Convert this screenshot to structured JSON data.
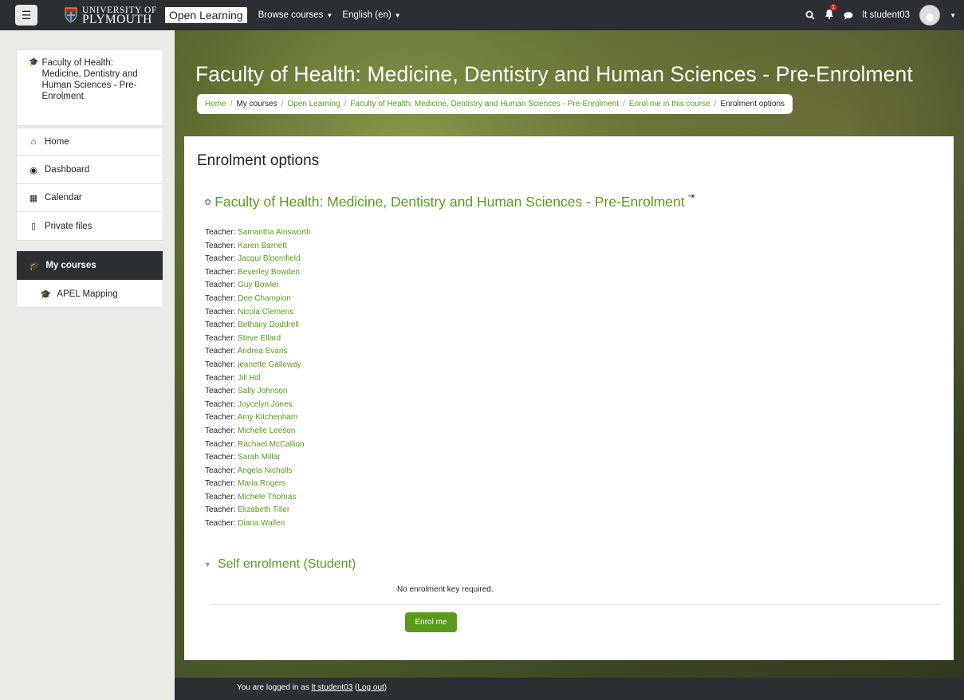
{
  "navbar": {
    "logo_line1": "UNIVERSITY OF",
    "logo_line2": "PLYMOUTH",
    "site_name": "Open Learning",
    "browse_label": "Browse courses",
    "language_label": "English (en)",
    "notifications_count": "1",
    "user_name": "lt student03"
  },
  "drawer": {
    "course_name_lines": [
      "Faculty of Health:",
      "Medicine, Dentistry and",
      "Human Sciences - Pre-",
      "Enrolment"
    ],
    "nav_items": [
      {
        "label": "Home",
        "icon": "home-icon"
      },
      {
        "label": "Dashboard",
        "icon": "dashboard-icon"
      },
      {
        "label": "Calendar",
        "icon": "calendar-icon"
      },
      {
        "label": "Private files",
        "icon": "file-icon"
      }
    ],
    "my_courses_label": "My courses",
    "my_courses_items": [
      "APEL Mapping"
    ]
  },
  "header": {
    "title": "Faculty of Health: Medicine, Dentistry and Human Sciences - Pre-Enrolment",
    "breadcrumb": [
      "Home",
      "My courses",
      "Open Learning",
      "Faculty of Health: Medicine, Dentistry and Human Sciences - Pre-Enrolment",
      "Enrol me in this course",
      "Enrolment options"
    ]
  },
  "main": {
    "heading": "Enrolment options",
    "course_title": "Faculty of Health: Medicine, Dentistry and Human Sciences - Pre-Enrolment",
    "teacher_label": "Teacher:",
    "teachers": [
      "Samantha Ainsworth",
      "Karen Barnett",
      "Jacqui Bloomfield",
      "Beverley Bowden",
      "Guy Bowler",
      "Dee Champion",
      "Nicola Clemens",
      "Bethany Doddrell",
      "Steve Ellard",
      "Andrea Evans",
      "jeanette Galloway",
      "Jill Hill",
      "Sally Johnson",
      "Joycelyn Jones",
      "Amy Kitchenham",
      "Michelle Leeson",
      "Rachael McCallion",
      "Sarah Millar",
      "Angela Nicholls",
      "Maria Rogers",
      "Michele Thomas",
      "Elizabeth Tiller",
      "Diana Wallen"
    ],
    "self_enrol_heading": "Self enrolment (Student)",
    "no_key_text": "No enrolment key required.",
    "enrol_button": "Enrol me"
  },
  "footer": {
    "logged_in_prefix": "You are logged in as ",
    "user_link": "lt student03",
    "logout_link": "Log out"
  }
}
